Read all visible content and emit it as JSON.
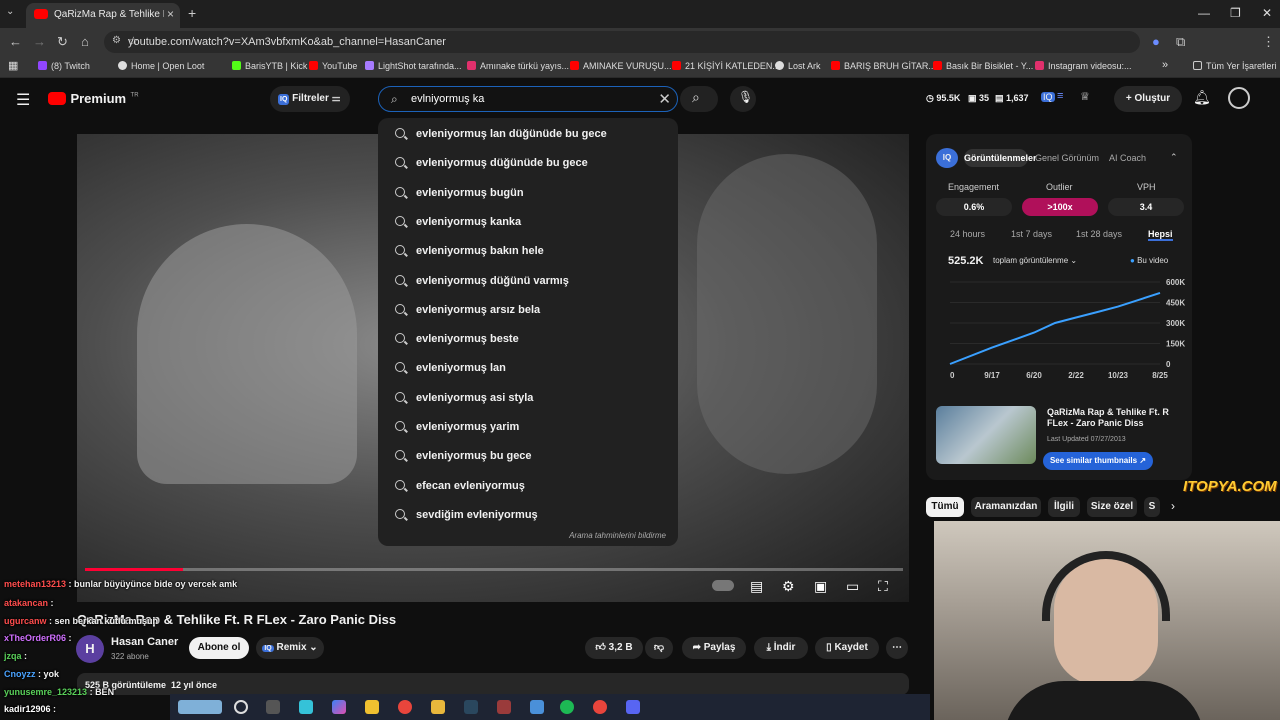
{
  "browser": {
    "tab_title": "QaRizMa Rap & Tehlike Ft. R Fl...",
    "url": "youtube.com/watch?v=XAm3vbfxmKo&ab_channel=HasanCaner",
    "bookmarks": [
      {
        "label": "(8) Twitch",
        "color": "#9146ff"
      },
      {
        "label": "Home | Open Loot",
        "color": "#dddddd"
      },
      {
        "label": "BarisYTB | Kick",
        "color": "#53fc18"
      },
      {
        "label": "YouTube",
        "color": "#ff0000"
      },
      {
        "label": "LightShot tarafında...",
        "color": "#a77bff"
      },
      {
        "label": "Amınake türkü yayıs...",
        "color": "#e1306c"
      },
      {
        "label": "AMINAKE VURUŞU...",
        "color": "#ff0000"
      },
      {
        "label": "21 KİŞİYİ KATLEDEN...",
        "color": "#ff0000"
      },
      {
        "label": "Lost Ark",
        "color": "#dddddd"
      },
      {
        "label": "BARIŞ BRUH GİTAR...",
        "color": "#ff0000"
      },
      {
        "label": "Basık Bir Bisiklet - Y...",
        "color": "#ff0000"
      },
      {
        "label": "Instagram videosu:...",
        "color": "#e1306c"
      }
    ],
    "all_bookmarks": "Tüm Yer İşaretleri"
  },
  "header": {
    "logo": "Premium",
    "logo_sup": "TR",
    "filters": "Filtreler",
    "stats": [
      "95.5K",
      "35",
      "1,637"
    ],
    "create": "Oluştur"
  },
  "search": {
    "query": "evlniyormuş ka",
    "suggestions": [
      "evleniyormuş lan düğünüde bu gece",
      "evleniyormuş düğünüde bu gece",
      "evleniyormuş bugün",
      "evleniyormuş kanka",
      "evleniyormuş bakın hele",
      "evleniyormuş düğünü varmış",
      "evleniyormuş arsız bela",
      "evleniyormuş beste",
      "evleniyormuş lan",
      "evleniyormuş asi styla",
      "evleniyormuş yarim",
      "evleniyormuş bu gece",
      "efecan evleniyormuş",
      "sevdiğim evleniyormuş"
    ],
    "report_note": "Arama tahminlerini bildirme"
  },
  "video": {
    "title": "QaRizMa Rap & Tehlike Ft. R FLex - Zaro Panic Diss",
    "progress": 0.12,
    "channel": "Hasan Caner",
    "subscribers": "322 abone",
    "subscribe": "Abone ol",
    "remix": "Remix",
    "likes": "3,2 B",
    "share": "Paylaş",
    "download": "İndir",
    "save": "Kaydet",
    "views_line": "525 B görüntüleme  12 yıl önce"
  },
  "panel": {
    "tabs": [
      "Görüntülenmeler",
      "Genel Görünüm",
      "AI Coach"
    ],
    "metrics": [
      {
        "label": "Engagement",
        "value": "0.6%"
      },
      {
        "label": "Outlier",
        "value": ">100x"
      },
      {
        "label": "VPH",
        "value": "3.4"
      }
    ],
    "ranges": [
      "24 hours",
      "1st 7 days",
      "1st 28 days",
      "Hepsi"
    ],
    "total": "525.2K",
    "total_label": "toplam görüntülenme",
    "legend": "Bu video",
    "related_title": "QaRizMa Rap & Tehlike Ft. R FLex - Zaro Panic Diss",
    "related_updated": "Last Updated 07/27/2013",
    "similar_btn": "See similar thumbnails"
  },
  "chart_data": {
    "type": "line",
    "x_ticks": [
      "0",
      "9/17",
      "6/20",
      "2/22",
      "10/23",
      "8/25"
    ],
    "y_ticks": [
      "600K",
      "450K",
      "300K",
      "150K",
      "0"
    ],
    "ylim": [
      0,
      600000
    ],
    "series": [
      {
        "name": "Bu video",
        "x": [
          0,
          1,
          2,
          2.5,
          3,
          3.5,
          4,
          4.5,
          5
        ],
        "values": [
          0,
          120000,
          230000,
          300000,
          340000,
          380000,
          420000,
          470000,
          520000
        ]
      }
    ]
  },
  "chips": [
    "Tümü",
    "Aramanızdan",
    "İlgili",
    "Size özel",
    "S"
  ],
  "chat": [
    {
      "user": "metehan13213",
      "color": "#ff4d4d",
      "msg": "bunlar büyüyünce bide oy vercek amk"
    },
    {
      "user": "atakancan",
      "color": "#ff4d4d",
      "msg": ""
    },
    {
      "user": "ugurcanw",
      "color": "#ff4d4d",
      "msg": "sen berkan kutlu muşun"
    },
    {
      "user": "xTheOrderR06",
      "color": "#d070ff",
      "msg": ""
    },
    {
      "user": "jzqa",
      "color": "#5ad15a",
      "msg": ""
    },
    {
      "user": "Cnoyzz",
      "color": "#4aa3ff",
      "msg": "yok"
    },
    {
      "user": "yunusemre_123213",
      "color": "#5ad15a",
      "msg": "BEN"
    },
    {
      "user": "kadir12906",
      "color": "#ffffff",
      "msg": ""
    }
  ],
  "watermark": "ITOPYA.COM"
}
